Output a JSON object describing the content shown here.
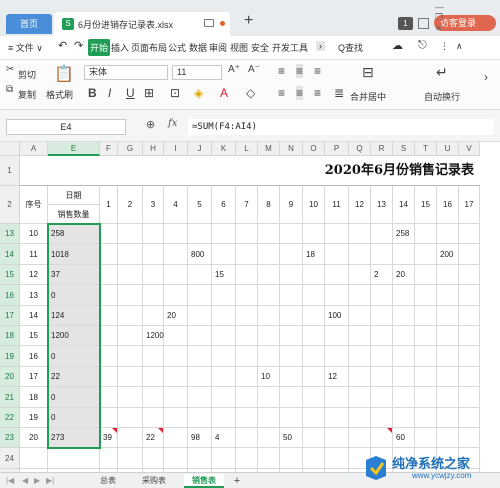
{
  "titlebar": {
    "home_tab": "首页",
    "file_tab": "6月份进销存记录表.xlsx",
    "add_tab": "+",
    "notif_badge": "1",
    "login_button": "访客登录",
    "window_controls": "— ❐ ✕"
  },
  "menu": {
    "file": "≡ 文件 ∨",
    "items": [
      "开始",
      "插入",
      "页面布局",
      "公式",
      "数据",
      "审阅",
      "视图",
      "安全",
      "开发工具"
    ],
    "search": "Q查找"
  },
  "ribbon": {
    "cut": "剪切",
    "copy": "复制",
    "format_painter": "格式刷",
    "paste": "粘贴",
    "font_name": "宋体",
    "font_size": "11",
    "merge": "合并居中",
    "wrap": "自动换行",
    "bold": "B",
    "italic": "I",
    "underline": "U"
  },
  "formula_bar": {
    "name_box": "E4",
    "fx": "fx",
    "formula": "=SUM(F4:AI4)"
  },
  "sheet": {
    "col_letters": [
      "A",
      "E",
      "F",
      "G",
      "H",
      "I",
      "J",
      "K",
      "L",
      "M",
      "N",
      "O",
      "P",
      "Q",
      "R",
      "S",
      "T",
      "U",
      "V"
    ],
    "title": "2020年6月份销售记录表",
    "header_seq": "序号",
    "header_date": "日期",
    "header_qty": "销售数量",
    "day_numbers": [
      "1",
      "2",
      "3",
      "4",
      "5",
      "6",
      "7",
      "8",
      "9",
      "10",
      "11",
      "12",
      "13",
      "14",
      "15",
      "16",
      "17"
    ],
    "rows": [
      {
        "row": "13",
        "seq": "10",
        "qty": "258",
        "days": {
          "14": "258"
        }
      },
      {
        "row": "14",
        "seq": "11",
        "qty": "1018",
        "days": {
          "5": "800",
          "10": "18",
          "16": "200"
        }
      },
      {
        "row": "15",
        "seq": "12",
        "qty": "37",
        "days": {
          "6": "15",
          "13": "2",
          "14": "20"
        }
      },
      {
        "row": "16",
        "seq": "13",
        "qty": "0",
        "days": {}
      },
      {
        "row": "17",
        "seq": "14",
        "qty": "124",
        "days": {
          "4": "20",
          "11": "100"
        }
      },
      {
        "row": "18",
        "seq": "15",
        "qty": "1200",
        "days": {
          "3": "1200"
        }
      },
      {
        "row": "19",
        "seq": "16",
        "qty": "0",
        "days": {}
      },
      {
        "row": "20",
        "seq": "17",
        "qty": "22",
        "days": {
          "8": "10",
          "11": "12"
        }
      },
      {
        "row": "21",
        "seq": "18",
        "qty": "0",
        "days": {}
      },
      {
        "row": "22",
        "seq": "19",
        "qty": "0",
        "days": {}
      },
      {
        "row": "23",
        "seq": "20",
        "qty": "273",
        "days": {
          "1": "39",
          "3": "22",
          "5": "98",
          "6": "4",
          "9": "50",
          "14": "60"
        }
      },
      {
        "row": "24",
        "seq": "",
        "qty": "",
        "days": {}
      },
      {
        "row": "25",
        "seq": "",
        "qty": "",
        "days": {}
      }
    ]
  },
  "sheet_tabs": [
    "总表",
    "采购表",
    "销售表"
  ],
  "sheet_add": "+",
  "watermark": {
    "text": "纯净系统之家",
    "url": "www.ycwjzy.com"
  },
  "colors": {
    "accent": "#1f9d55",
    "home_tab": "#4a8ed9",
    "login": "#e0674f"
  }
}
